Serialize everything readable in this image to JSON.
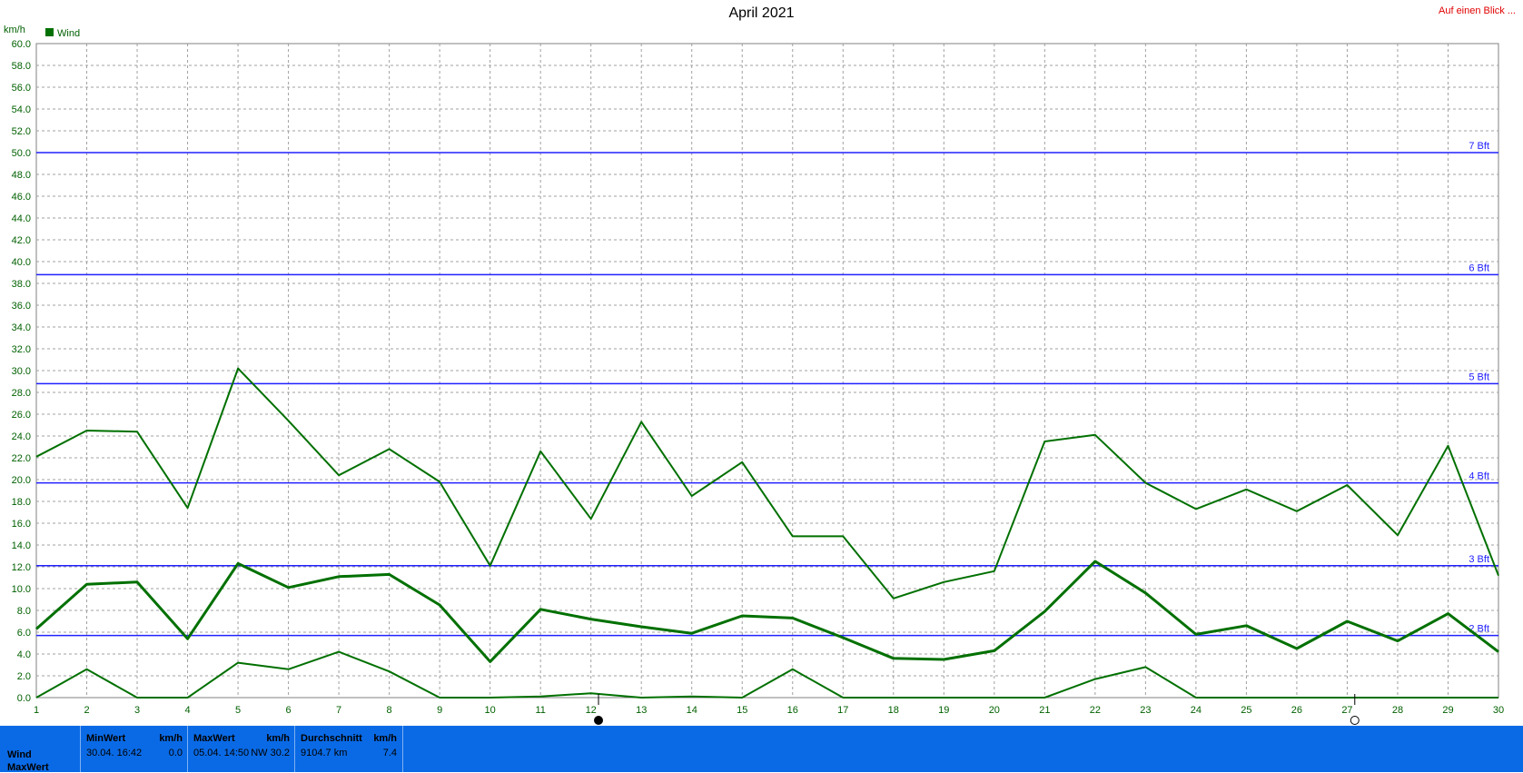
{
  "header": {
    "title": "April 2021",
    "link": "Auf einen Blick ..."
  },
  "chart_data": {
    "type": "line",
    "title": "April 2021",
    "ylabel": "km/h",
    "ylim": [
      0,
      60
    ],
    "y_ticks": [
      "0.0",
      "2.0",
      "4.0",
      "6.0",
      "8.0",
      "10.0",
      "12.0",
      "14.0",
      "16.0",
      "18.0",
      "20.0",
      "22.0",
      "24.0",
      "26.0",
      "28.0",
      "30.0",
      "32.0",
      "34.0",
      "36.0",
      "38.0",
      "40.0",
      "42.0",
      "44.0",
      "46.0",
      "48.0",
      "50.0",
      "52.0",
      "54.0",
      "56.0",
      "58.0",
      "60.0"
    ],
    "x": [
      1,
      2,
      3,
      4,
      5,
      6,
      7,
      8,
      9,
      10,
      11,
      12,
      13,
      14,
      15,
      16,
      17,
      18,
      19,
      20,
      21,
      22,
      23,
      24,
      25,
      26,
      27,
      28,
      29,
      30
    ],
    "legend": [
      "Wind"
    ],
    "series_color": "#007000",
    "series": [
      {
        "values": [
          22.1,
          24.5,
          24.4,
          17.4,
          30.2,
          25.4,
          20.4,
          22.8,
          19.8,
          12.1,
          22.6,
          16.4,
          25.3,
          18.5,
          21.6,
          14.8,
          14.8,
          9.1,
          10.6,
          11.6,
          23.5,
          24.1,
          19.7,
          17.3,
          19.1,
          17.1,
          19.5,
          14.9,
          23.1,
          11.2
        ]
      },
      {
        "values": [
          6.3,
          10.4,
          10.6,
          5.4,
          12.3,
          10.1,
          11.1,
          11.3,
          8.5,
          3.3,
          8.1,
          7.2,
          6.5,
          5.9,
          7.5,
          7.3,
          5.5,
          3.6,
          3.5,
          4.3,
          7.9,
          12.5,
          9.6,
          5.8,
          6.6,
          4.5,
          7.0,
          5.2,
          7.7,
          4.2
        ]
      },
      {
        "values": [
          0.0,
          2.6,
          0.0,
          0.0,
          3.2,
          2.6,
          4.2,
          2.4,
          0.0,
          0.0,
          0.1,
          0.4,
          0.0,
          0.1,
          0.0,
          2.6,
          0.0,
          0.0,
          0.0,
          0.0,
          0.0,
          1.7,
          2.8,
          0.0,
          0.0,
          0.0,
          0.0,
          0.0,
          0.0,
          0.0
        ]
      }
    ],
    "reference_lines": [
      {
        "value": 50.0,
        "label": "7 Bft"
      },
      {
        "value": 38.8,
        "label": "6 Bft"
      },
      {
        "value": 28.8,
        "label": "5 Bft"
      },
      {
        "value": 19.7,
        "label": "4 Bft"
      },
      {
        "value": 12.1,
        "label": "3 Bft"
      },
      {
        "value": 5.7,
        "label": "2 Bft"
      }
    ],
    "reference_color": "#2020ff",
    "moon_phases": [
      {
        "x": 12,
        "phase": "full"
      },
      {
        "x": 27,
        "phase": "new"
      }
    ],
    "grid": true
  },
  "footer": {
    "row1": "Wind",
    "row2": "MaxWert",
    "min": {
      "label": "MinWert",
      "unit": "km/h",
      "time": "30.04.  16:42",
      "value": "0.0"
    },
    "max": {
      "label": "MaxWert",
      "unit": "km/h",
      "time": "05.04.  14:50",
      "dir_value": "NW 30.2"
    },
    "avg": {
      "label": "Durchschnitt",
      "unit": "km/h",
      "distance": "9104.7 km",
      "value": "7.4"
    }
  }
}
